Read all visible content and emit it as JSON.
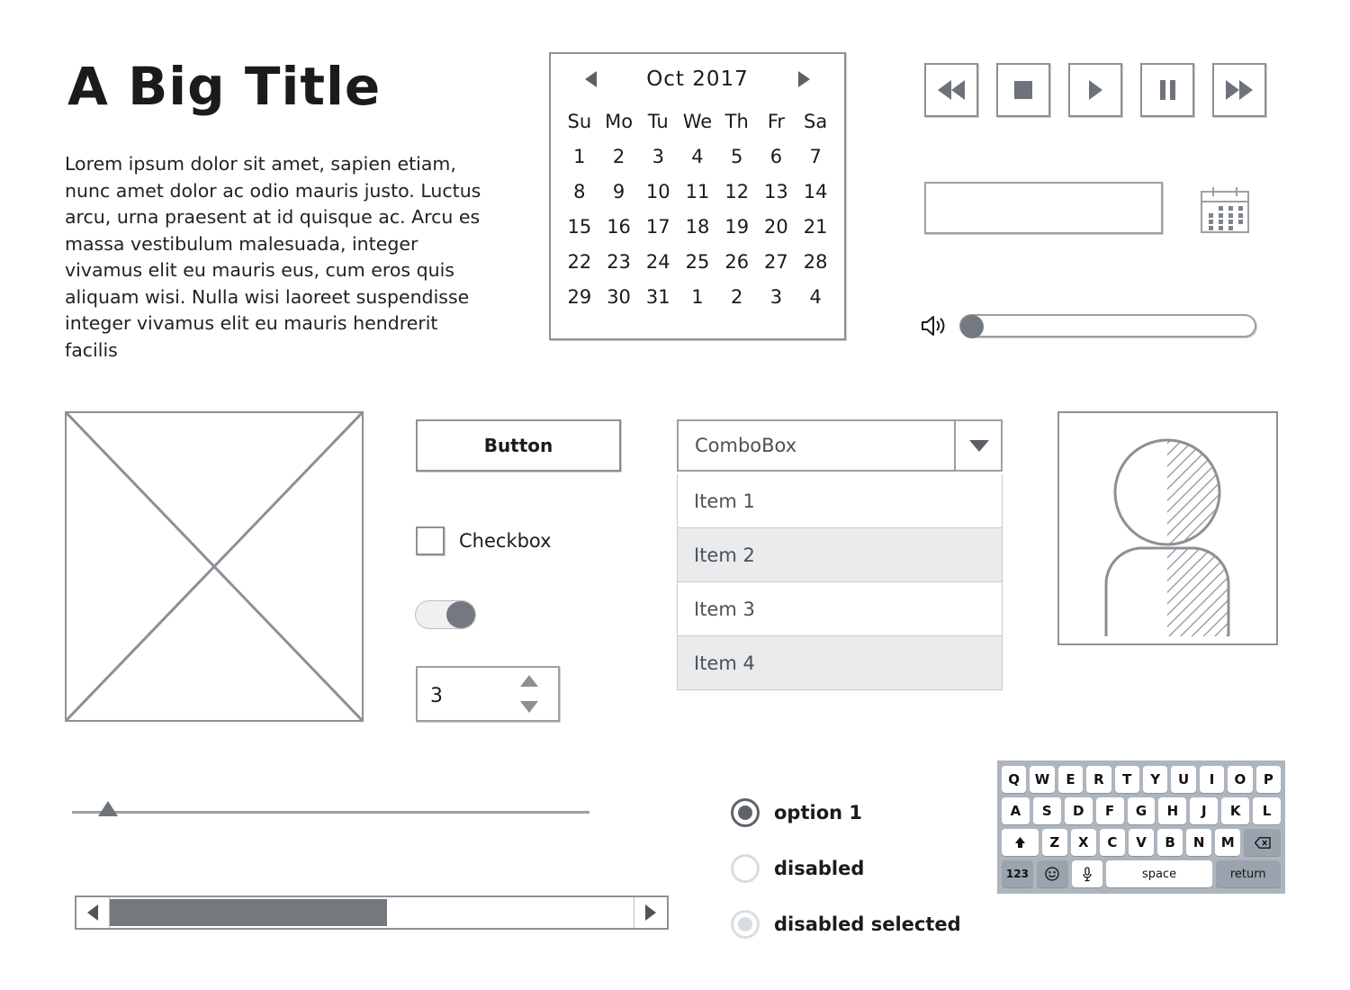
{
  "header": {
    "title": "A Big Title",
    "body_text": "Lorem ipsum dolor sit amet, sapien etiam, nunc amet dolor ac odio mauris justo. Luctus arcu, urna praesent at id quisque ac. Arcu es massa vestibulum malesuada, integer vivamus elit eu mauris eus, cum eros quis aliquam wisi. Nulla wisi laoreet suspendisse integer vivamus elit eu mauris hendrerit facilis"
  },
  "calendar": {
    "month_label": "Oct 2017",
    "prev_icon": "triangle-left-icon",
    "next_icon": "triangle-right-icon",
    "day_headers": [
      "Su",
      "Mo",
      "Tu",
      "We",
      "Th",
      "Fr",
      "Sa"
    ],
    "weeks": [
      [
        {
          "d": "1",
          "s": "normal"
        },
        {
          "d": "2",
          "s": "normal"
        },
        {
          "d": "3",
          "s": "normal"
        },
        {
          "d": "4",
          "s": "normal"
        },
        {
          "d": "5",
          "s": "normal"
        },
        {
          "d": "6",
          "s": "normal"
        },
        {
          "d": "7",
          "s": "normal"
        }
      ],
      [
        {
          "d": "8",
          "s": "normal"
        },
        {
          "d": "9",
          "s": "normal"
        },
        {
          "d": "10",
          "s": "normal"
        },
        {
          "d": "11",
          "s": "normal"
        },
        {
          "d": "12",
          "s": "normal"
        },
        {
          "d": "13",
          "s": "normal"
        },
        {
          "d": "14",
          "s": "normal"
        }
      ],
      [
        {
          "d": "15",
          "s": "normal"
        },
        {
          "d": "16",
          "s": "normal"
        },
        {
          "d": "17",
          "s": "today"
        },
        {
          "d": "18",
          "s": "normal"
        },
        {
          "d": "19",
          "s": "normal"
        },
        {
          "d": "20",
          "s": "normal"
        },
        {
          "d": "21",
          "s": "normal"
        }
      ],
      [
        {
          "d": "22",
          "s": "normal"
        },
        {
          "d": "23",
          "s": "normal"
        },
        {
          "d": "24",
          "s": "normal"
        },
        {
          "d": "25",
          "s": "normal"
        },
        {
          "d": "26",
          "s": "normal"
        },
        {
          "d": "27",
          "s": "normal"
        },
        {
          "d": "28",
          "s": "normal"
        }
      ],
      [
        {
          "d": "29",
          "s": "normal"
        },
        {
          "d": "30",
          "s": "normal"
        },
        {
          "d": "31",
          "s": "normal"
        },
        {
          "d": "1",
          "s": "muted"
        },
        {
          "d": "2",
          "s": "muted"
        },
        {
          "d": "3",
          "s": "muted"
        },
        {
          "d": "4",
          "s": "muted"
        }
      ]
    ]
  },
  "media_controls": [
    {
      "name": "rewind-button",
      "icon": "rewind-icon"
    },
    {
      "name": "stop-button",
      "icon": "stop-icon"
    },
    {
      "name": "play-button",
      "icon": "play-icon"
    },
    {
      "name": "pause-button",
      "icon": "pause-icon"
    },
    {
      "name": "fast-forward-button",
      "icon": "fast-forward-icon"
    }
  ],
  "text_field": {
    "value": "",
    "placeholder": ""
  },
  "date_picker_icon": "calendar-icon",
  "volume": {
    "icon": "speaker-icon",
    "value": 0
  },
  "image_placeholder": {
    "icon": "image-placeholder-icon"
  },
  "button": {
    "label": "Button"
  },
  "checkbox": {
    "label": "Checkbox",
    "checked": false
  },
  "toggle": {
    "state": "on"
  },
  "spinner": {
    "value": "3",
    "up_icon": "triangle-up-icon",
    "down_icon": "triangle-down-icon"
  },
  "combobox": {
    "value": "ComboBox",
    "arrow_icon": "chevron-down-icon",
    "items": [
      "Item 1",
      "Item 2",
      "Item 3",
      "Item 4"
    ]
  },
  "avatar": {
    "icon": "user-avatar-icon"
  },
  "slider": {
    "value": 5
  },
  "scrollbar": {
    "left_icon": "triangle-left-icon",
    "right_icon": "triangle-right-icon",
    "thumb_percent": 53
  },
  "radios": [
    {
      "label": "option 1",
      "state": "selected"
    },
    {
      "label": "disabled",
      "state": "disabled"
    },
    {
      "label": "disabled selected",
      "state": "disabled-selected"
    }
  ],
  "keyboard": {
    "row1": [
      "Q",
      "W",
      "E",
      "R",
      "T",
      "Y",
      "U",
      "I",
      "O",
      "P"
    ],
    "row2": [
      "A",
      "S",
      "D",
      "F",
      "G",
      "H",
      "J",
      "K",
      "L"
    ],
    "row3_letters": [
      "Z",
      "X",
      "C",
      "V",
      "B",
      "N",
      "M"
    ],
    "shift_icon": "shift-icon",
    "backspace_icon": "backspace-icon",
    "numbers_key": "123",
    "emoji_icon": "emoji-icon",
    "mic_icon": "microphone-icon",
    "space_key": "space",
    "return_key": "return"
  },
  "colors": {
    "stroke": "#8c9096",
    "fill_gray": "#73797f",
    "muted": "#d7dbe0",
    "keyboard_bg": "#adb5bd"
  }
}
